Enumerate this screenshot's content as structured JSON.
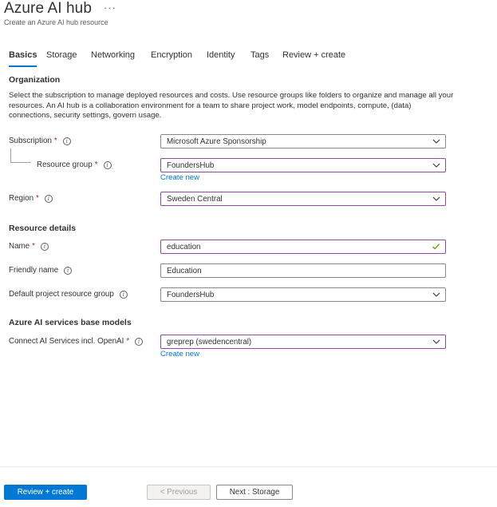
{
  "header": {
    "title": "Azure AI hub",
    "more": "···",
    "subtitle": "Create an Azure AI hub resource"
  },
  "tabs": [
    {
      "label": "Basics",
      "active": true
    },
    {
      "label": "Storage"
    },
    {
      "label": "Networking"
    },
    {
      "label": "Encryption"
    },
    {
      "label": "Identity"
    },
    {
      "label": "Tags"
    },
    {
      "label": "Review + create"
    }
  ],
  "organization": {
    "title": "Organization",
    "description": "Select the subscription to manage deployed resources and costs. Use resource groups like folders to organize and manage all your resources. An AI hub is a collaboration environment for a team to share project work, model endpoints, compute, (data) connections, security settings, govern usage.",
    "subscription": {
      "label": "Subscription",
      "value": "Microsoft Azure Sponsorship"
    },
    "resource_group": {
      "label": "Resource group",
      "value": "FoundersHub",
      "create_new": "Create new"
    },
    "region": {
      "label": "Region",
      "value": "Sweden Central"
    }
  },
  "resource_details": {
    "title": "Resource details",
    "name": {
      "label": "Name",
      "value": "education"
    },
    "friendly_name": {
      "label": "Friendly name",
      "value": "Education"
    },
    "default_rg": {
      "label": "Default project resource group",
      "value": "FoundersHub"
    }
  },
  "base_models": {
    "title": "Azure AI services base models",
    "connect": {
      "label": "Connect AI Services incl. OpenAI",
      "value": "greprep (swedencentral)",
      "create_new": "Create new"
    }
  },
  "footer": {
    "review_create": "Review + create",
    "previous": "< Previous",
    "next": "Next : Storage"
  },
  "colors": {
    "accent": "#0078d4",
    "required": "#a4262c",
    "focus_border": "#8e4a9e",
    "valid_check": "#57a300"
  },
  "icons": {
    "info": "info-icon",
    "dropdown": "chevron-down-icon",
    "valid": "checkmark-icon"
  },
  "required_marker": "*",
  "info_glyph": "i"
}
